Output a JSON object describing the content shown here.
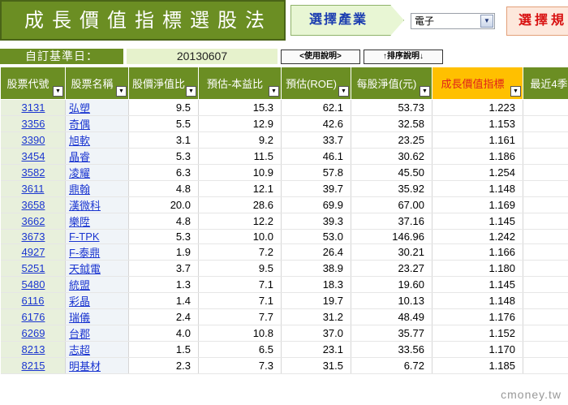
{
  "header": {
    "title": "成長價值指標選股法",
    "industry_button": "選擇產業",
    "industry_value": "電子",
    "rule_button": "選擇規"
  },
  "toolbar": {
    "ref_date_label": "自訂基準日：",
    "ref_date_value": "20130607",
    "usage_button": "<使用說明>",
    "sort_button": "↑排序說明↓"
  },
  "table": {
    "columns": [
      "股票代號",
      "股票名稱",
      "股價淨值比",
      "預估-本益比",
      "預估(ROE)",
      "每股淨值(元)",
      "成長價值指標",
      "最近4季"
    ],
    "rows": [
      [
        "3131",
        "弘塑",
        "9.5",
        "15.3",
        "62.1",
        "53.73",
        "1.223"
      ],
      [
        "3356",
        "奇偶",
        "5.5",
        "12.9",
        "42.6",
        "32.58",
        "1.153"
      ],
      [
        "3390",
        "旭軟",
        "3.1",
        "9.2",
        "33.7",
        "23.25",
        "1.161"
      ],
      [
        "3454",
        "晶睿",
        "5.3",
        "11.5",
        "46.1",
        "30.62",
        "1.186"
      ],
      [
        "3582",
        "凌耀",
        "6.3",
        "10.9",
        "57.8",
        "45.50",
        "1.254"
      ],
      [
        "3611",
        "鼎翰",
        "4.8",
        "12.1",
        "39.7",
        "35.92",
        "1.148"
      ],
      [
        "3658",
        "漢微科",
        "20.0",
        "28.6",
        "69.9",
        "67.00",
        "1.169"
      ],
      [
        "3662",
        "樂陞",
        "4.8",
        "12.2",
        "39.3",
        "37.16",
        "1.145"
      ],
      [
        "3673",
        "F-TPK",
        "5.3",
        "10.0",
        "53.0",
        "146.96",
        "1.242"
      ],
      [
        "4927",
        "F-泰鼎",
        "1.9",
        "7.2",
        "26.4",
        "30.21",
        "1.166"
      ],
      [
        "5251",
        "天鉞電",
        "3.7",
        "9.5",
        "38.9",
        "23.27",
        "1.180"
      ],
      [
        "5480",
        "統盟",
        "1.3",
        "7.1",
        "18.3",
        "19.60",
        "1.145"
      ],
      [
        "6116",
        "彩晶",
        "1.4",
        "7.1",
        "19.7",
        "10.13",
        "1.148"
      ],
      [
        "6176",
        "瑞儀",
        "2.4",
        "7.7",
        "31.2",
        "48.49",
        "1.176"
      ],
      [
        "6269",
        "台郡",
        "4.0",
        "10.8",
        "37.0",
        "35.77",
        "1.152"
      ],
      [
        "8213",
        "志超",
        "1.5",
        "6.5",
        "23.1",
        "33.56",
        "1.170"
      ],
      [
        "8215",
        "明基材",
        "2.3",
        "7.3",
        "31.5",
        "6.72",
        "1.185"
      ]
    ]
  },
  "footer": {
    "watermark": "cmoney.tw"
  }
}
